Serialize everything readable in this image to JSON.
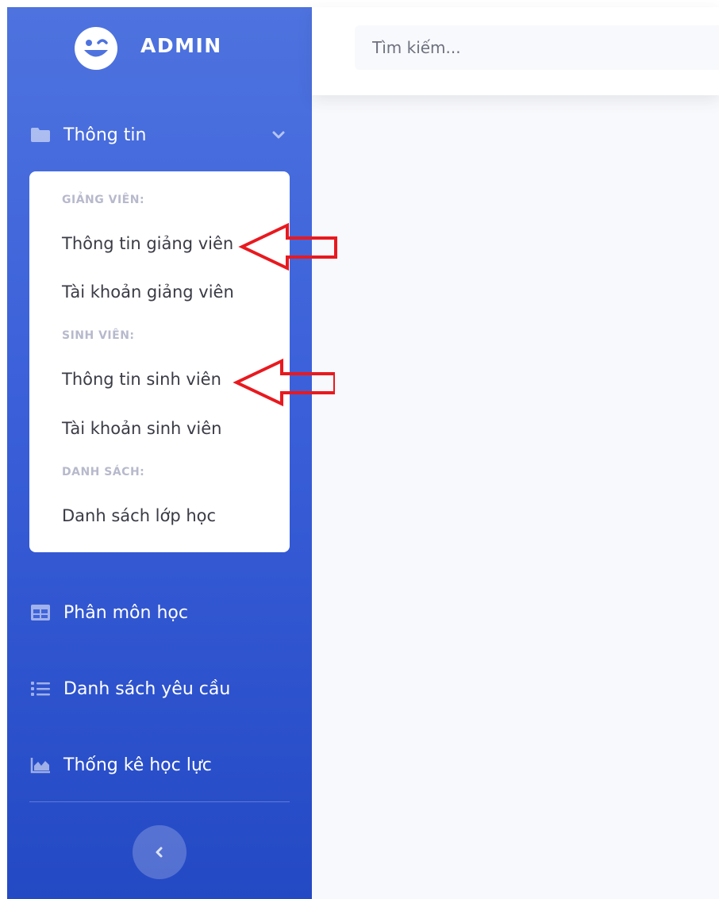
{
  "brand": {
    "name": "ADMIN",
    "logo_icon": "laugh-wink-icon"
  },
  "search": {
    "placeholder": "Tìm kiếm..."
  },
  "sidebar": {
    "info_menu": {
      "label": "Thông tin",
      "icon": "folder-icon",
      "expanded": true,
      "sections": [
        {
          "header": "GIẢNG VIÊN:",
          "items": [
            "Thông tin giảng viên",
            "Tài khoản giảng viên"
          ]
        },
        {
          "header": "SINH VIÊN:",
          "items": [
            "Thông tin sinh viên",
            "Tài khoản sinh viên"
          ]
        },
        {
          "header": "DANH SÁCH:",
          "items": [
            "Danh sách lớp học"
          ]
        }
      ]
    },
    "items": [
      {
        "label": "Phân môn học",
        "icon": "table-icon"
      },
      {
        "label": "Danh sách yêu cầu",
        "icon": "list-icon"
      },
      {
        "label": "Thống kê học lực",
        "icon": "area-chart-icon"
      }
    ],
    "toggle_icon": "chevron-left-icon"
  },
  "colors": {
    "sidebar_top": "#4e73df",
    "sidebar_bottom": "#2449c4",
    "annotation_arrow": "#e8191f"
  }
}
